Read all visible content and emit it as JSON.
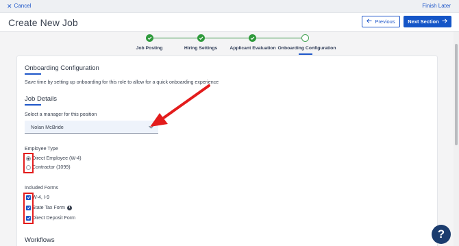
{
  "topbar": {
    "cancel_label": "Cancel",
    "finish_label": "Finish Later"
  },
  "header": {
    "title": "Create New Job",
    "previous_label": "Previous",
    "next_label": "Next Section"
  },
  "steps": [
    {
      "label": "Job Posting",
      "status": "done"
    },
    {
      "label": "Hiring Settings",
      "status": "done"
    },
    {
      "label": "Applicant Evaluation",
      "status": "done"
    },
    {
      "label": "Onboarding Configuration",
      "status": "current"
    }
  ],
  "onboarding": {
    "title": "Onboarding Configuration",
    "description": "Save time by setting up onboarding for this role to allow for a quick onboarding experience"
  },
  "job_details": {
    "title": "Job Details",
    "manager_label": "Select a manager for this position",
    "manager_value": "Nolan McBride"
  },
  "employee_type": {
    "label": "Employee Type",
    "options": [
      {
        "label": "Direct Employee (W-4)",
        "selected": true
      },
      {
        "label": "Contractor (1099)",
        "selected": false
      }
    ]
  },
  "included_forms": {
    "label": "Included Forms",
    "options": [
      {
        "label": "W-4, I-9",
        "checked": true
      },
      {
        "label": "State Tax Form",
        "checked": true
      },
      {
        "label": "Direct Deposit Form",
        "checked": true
      }
    ]
  },
  "workflows": {
    "title": "Workflows"
  },
  "help": {
    "label": "?"
  },
  "colors": {
    "accent": "#1455c7",
    "success": "#2f9a3c",
    "annotation": "#e31c1c",
    "help_bg": "#1b3c6e"
  }
}
